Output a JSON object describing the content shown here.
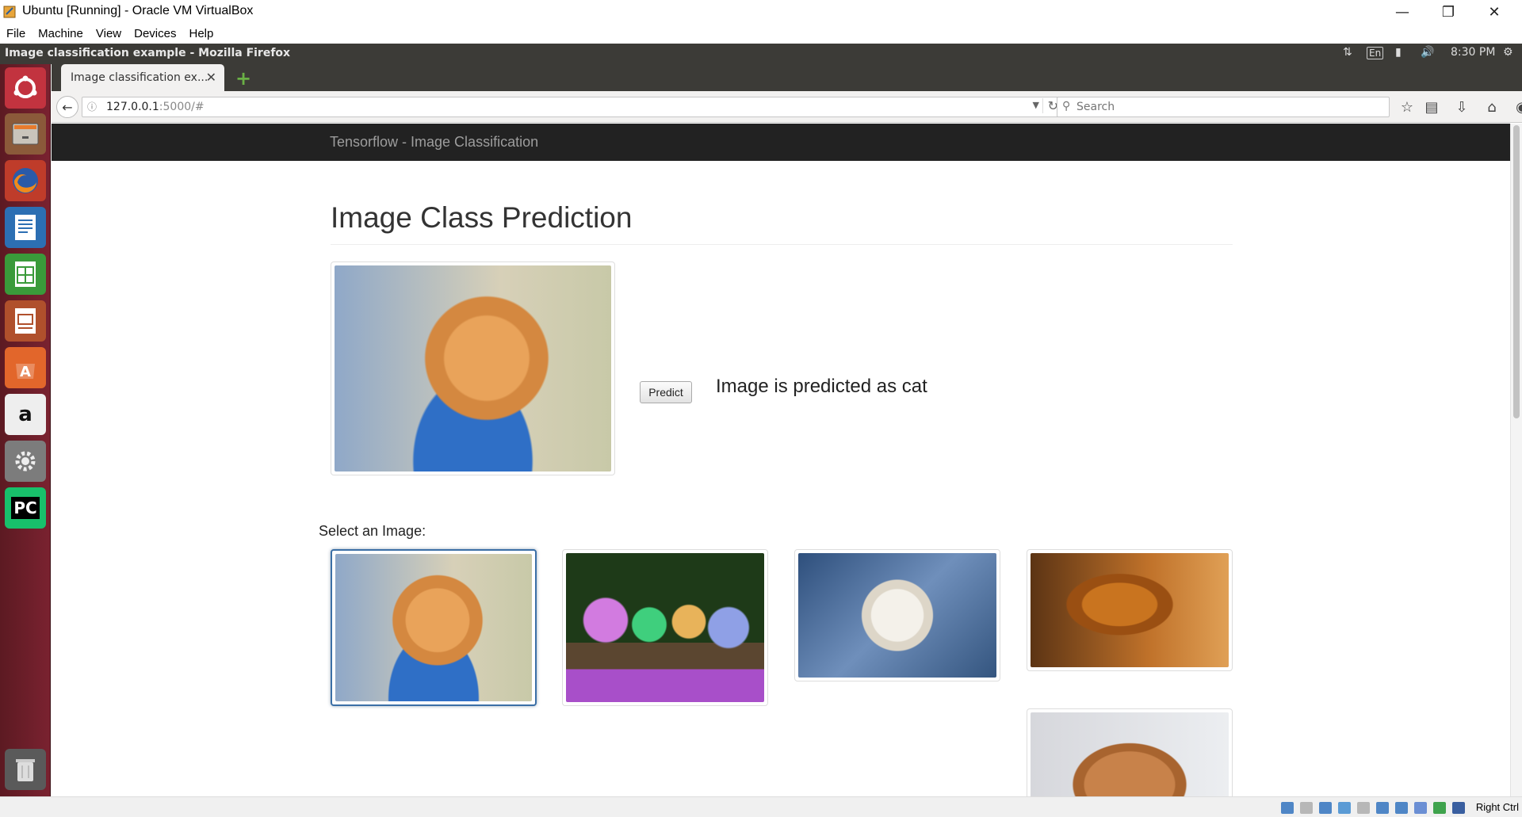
{
  "vbox": {
    "title": "Ubuntu [Running] - Oracle VM VirtualBox",
    "menu": [
      "File",
      "Machine",
      "View",
      "Devices",
      "Help"
    ],
    "host_key": "Right Ctrl"
  },
  "ubuntu_panel": {
    "window_title": "Image classification example - Mozilla Firefox",
    "keyboard_layout": "En",
    "clock": "8:30 PM"
  },
  "launcher": {
    "items": [
      "ubuntu-dash",
      "files",
      "firefox",
      "libreoffice-writer",
      "libreoffice-calc",
      "libreoffice-impress",
      "ubuntu-software",
      "amazon",
      "system-settings",
      "pycharm",
      "trash"
    ],
    "pycharm_label": "PC",
    "amazon_label": "a"
  },
  "browser": {
    "tab_title": "Image classification ex...",
    "url_host": "127.0.0.1",
    "url_path": ":5000/#",
    "search_placeholder": "Search"
  },
  "page": {
    "navbar_brand": "Tensorflow - Image Classification",
    "heading": "Image Class Prediction",
    "predict_button": "Predict",
    "result_text": "Image is predicted as cat",
    "select_label": "Select an Image:",
    "gallery": [
      "orange kitten",
      "four colored kittens",
      "white kitten in denim",
      "golden retriever",
      "puppy"
    ],
    "selected_index": 0
  },
  "colors": {
    "navbar_bg": "#222222",
    "launcher_bg": "#6e1f2a",
    "selected_border": "#3b6fa6"
  }
}
